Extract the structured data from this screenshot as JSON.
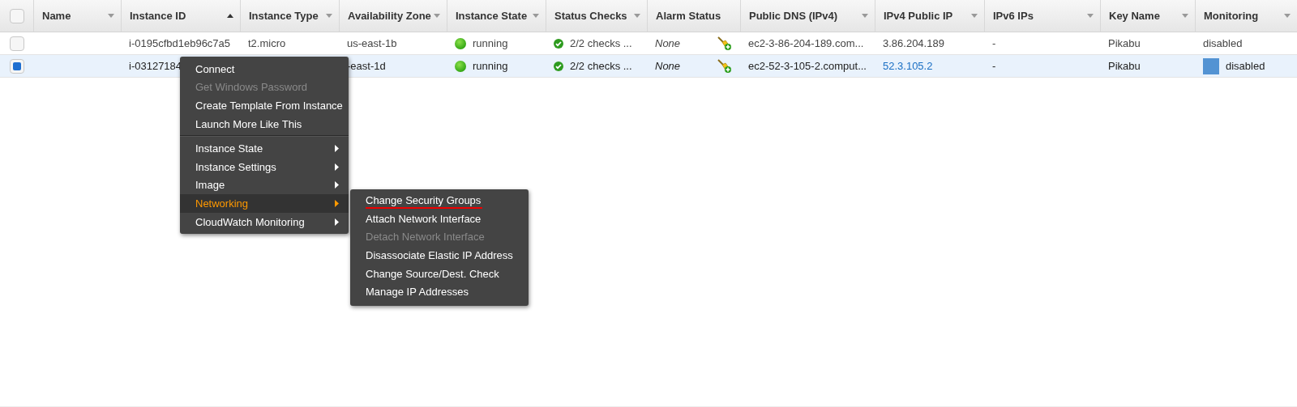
{
  "table": {
    "header_checkbox": {
      "checked": false
    },
    "columns": [
      {
        "label": "Name",
        "sorted": false,
        "dropdown": true
      },
      {
        "label": "Instance ID",
        "sorted": true,
        "dropdown": false
      },
      {
        "label": "Instance Type",
        "sorted": false,
        "dropdown": true
      },
      {
        "label": "Availability Zone",
        "sorted": false,
        "dropdown": true
      },
      {
        "label": "Instance State",
        "sorted": false,
        "dropdown": true
      },
      {
        "label": "Status Checks",
        "sorted": false,
        "dropdown": true
      },
      {
        "label": "Alarm Status",
        "sorted": false,
        "dropdown": false
      },
      {
        "label": "Public DNS (IPv4)",
        "sorted": false,
        "dropdown": true
      },
      {
        "label": "IPv4 Public IP",
        "sorted": false,
        "dropdown": true
      },
      {
        "label": "IPv6 IPs",
        "sorted": false,
        "dropdown": true
      },
      {
        "label": "Key Name",
        "sorted": false,
        "dropdown": true
      },
      {
        "label": "Monitoring",
        "sorted": false,
        "dropdown": true
      }
    ],
    "rows": [
      {
        "selected": false,
        "checked": false,
        "cells": [
          {
            "kind": "empty"
          },
          {
            "kind": "text",
            "text": "i-0195cfbd1eb96c7a5"
          },
          {
            "kind": "text",
            "text": "t2.micro"
          },
          {
            "kind": "text",
            "text": "us-east-1b"
          },
          {
            "kind": "state",
            "text": "running"
          },
          {
            "kind": "checks",
            "text": "2/2 checks ..."
          },
          {
            "kind": "alarm",
            "text": "None"
          },
          {
            "kind": "text",
            "text": "ec2-3-86-204-189.com..."
          },
          {
            "kind": "text",
            "text": "3.86.204.189"
          },
          {
            "kind": "text",
            "text": "-"
          },
          {
            "kind": "text",
            "text": "Pikabu"
          },
          {
            "kind": "text",
            "text": "disabled"
          }
        ]
      },
      {
        "selected": true,
        "checked": true,
        "cells": [
          {
            "kind": "empty"
          },
          {
            "kind": "text",
            "text": "i-03127184"
          },
          {
            "kind": "empty"
          },
          {
            "kind": "text",
            "text": "-east-1d"
          },
          {
            "kind": "state",
            "text": "running"
          },
          {
            "kind": "checks",
            "text": "2/2 checks ..."
          },
          {
            "kind": "alarm",
            "text": "None"
          },
          {
            "kind": "text",
            "text": "ec2-52-3-105-2.comput..."
          },
          {
            "kind": "link",
            "text": "52.3.105.2"
          },
          {
            "kind": "text",
            "text": "-"
          },
          {
            "kind": "text",
            "text": "Pikabu"
          },
          {
            "kind": "monitor",
            "text": "disabled"
          }
        ]
      }
    ]
  },
  "context_menu": {
    "items": [
      {
        "kind": "action",
        "label": "Connect",
        "disabled": false,
        "selected": false
      },
      {
        "kind": "action",
        "label": "Get Windows Password",
        "disabled": true,
        "selected": false
      },
      {
        "kind": "action",
        "label": "Create Template From Instance",
        "disabled": false,
        "selected": false
      },
      {
        "kind": "action",
        "label": "Launch More Like This",
        "disabled": false,
        "selected": false
      },
      {
        "kind": "separator"
      },
      {
        "kind": "submenu",
        "label": "Instance State",
        "disabled": false,
        "selected": false
      },
      {
        "kind": "submenu",
        "label": "Instance Settings",
        "disabled": false,
        "selected": false
      },
      {
        "kind": "submenu",
        "label": "Image",
        "disabled": false,
        "selected": false
      },
      {
        "kind": "submenu",
        "label": "Networking",
        "disabled": false,
        "selected": true
      },
      {
        "kind": "submenu",
        "label": "CloudWatch Monitoring",
        "disabled": false,
        "selected": false
      }
    ]
  },
  "submenu": {
    "items": [
      {
        "label": "Change Security Groups",
        "disabled": false,
        "underlined": true
      },
      {
        "label": "Attach Network Interface",
        "disabled": false,
        "underlined": false
      },
      {
        "label": "Detach Network Interface",
        "disabled": true,
        "underlined": false
      },
      {
        "label": "Disassociate Elastic IP Address",
        "disabled": false,
        "underlined": false
      },
      {
        "label": "Change Source/Dest. Check",
        "disabled": false,
        "underlined": false
      },
      {
        "label": "Manage IP Addresses",
        "disabled": false,
        "underlined": false
      }
    ]
  }
}
